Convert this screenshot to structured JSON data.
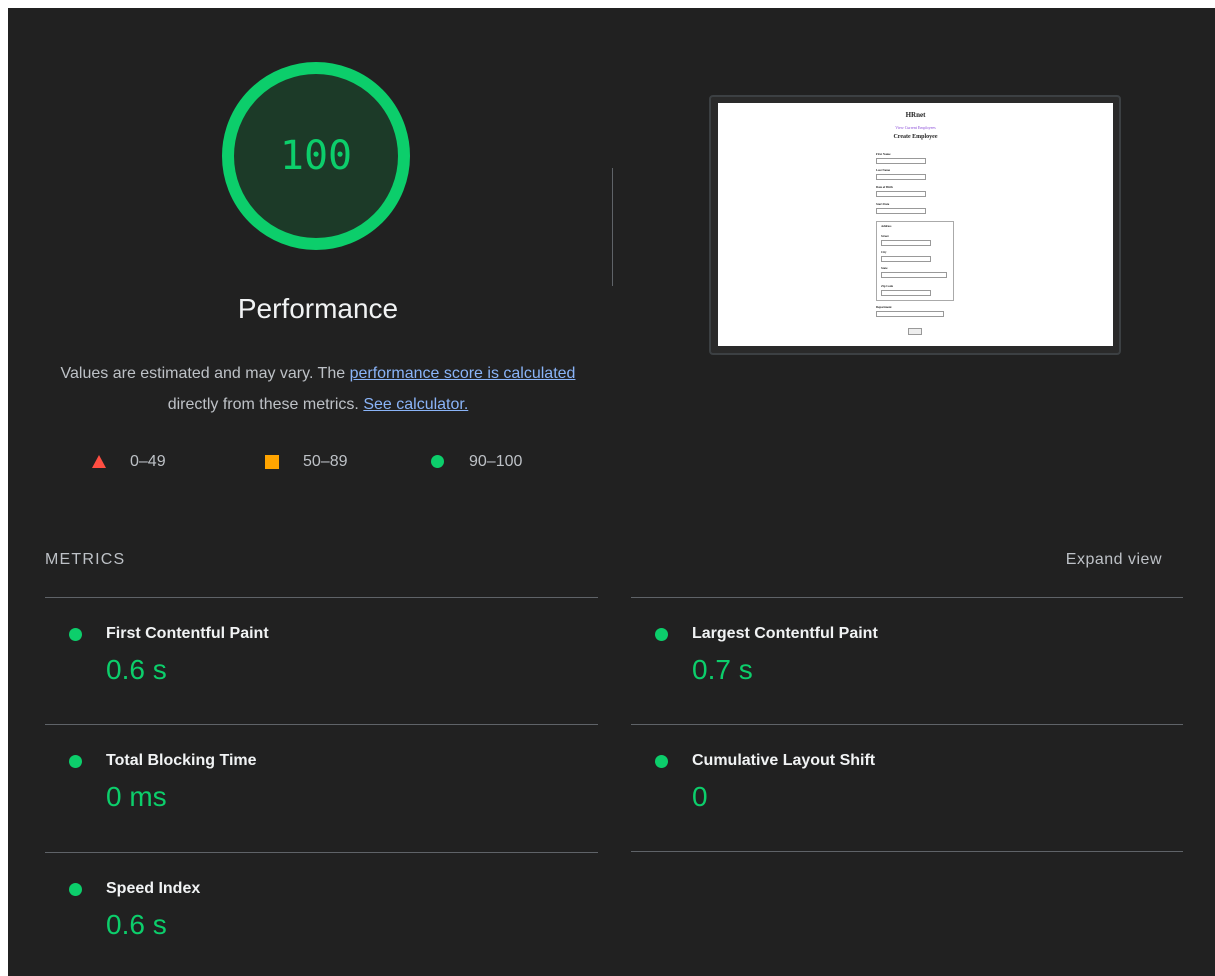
{
  "gauge": {
    "score": "100",
    "score_fraction": 1.0,
    "title": "Performance",
    "color": "#0cce6b"
  },
  "description": {
    "part1": "Values are estimated and may vary. The ",
    "link1": "performance score is calculated",
    "part2": " directly from these metrics. ",
    "link2": "See calculator."
  },
  "legend": [
    {
      "icon": "triangle-icon",
      "label": "0–49",
      "color": "#ff4e42"
    },
    {
      "icon": "square-icon",
      "label": "50–89",
      "color": "#ffa400"
    },
    {
      "icon": "circle-icon",
      "label": "90–100",
      "color": "#0cce6b"
    }
  ],
  "screenshot": {
    "title": "HRnet",
    "link": "View Current Employees",
    "heading": "Create Employee",
    "fields": [
      "First Name",
      "Last Name",
      "Date of Birth",
      "Start Date"
    ],
    "address_fields": [
      "Address",
      "Street",
      "City",
      "State",
      "Zip Code"
    ],
    "department_label": "Department",
    "button_label": "Save"
  },
  "metrics_section": {
    "header": "METRICS",
    "expand_label": "Expand view"
  },
  "metrics": [
    {
      "title": "First Contentful Paint",
      "value": "0.6 s"
    },
    {
      "title": "Largest Contentful Paint",
      "value": "0.7 s"
    },
    {
      "title": "Total Blocking Time",
      "value": "0 ms"
    },
    {
      "title": "Cumulative Layout Shift",
      "value": "0"
    },
    {
      "title": "Speed Index",
      "value": "0.6 s"
    }
  ],
  "colors": {
    "background": "#212121",
    "pass": "#0cce6b",
    "average": "#ffa400",
    "fail": "#ff4e42",
    "link": "#8ab4f8"
  }
}
